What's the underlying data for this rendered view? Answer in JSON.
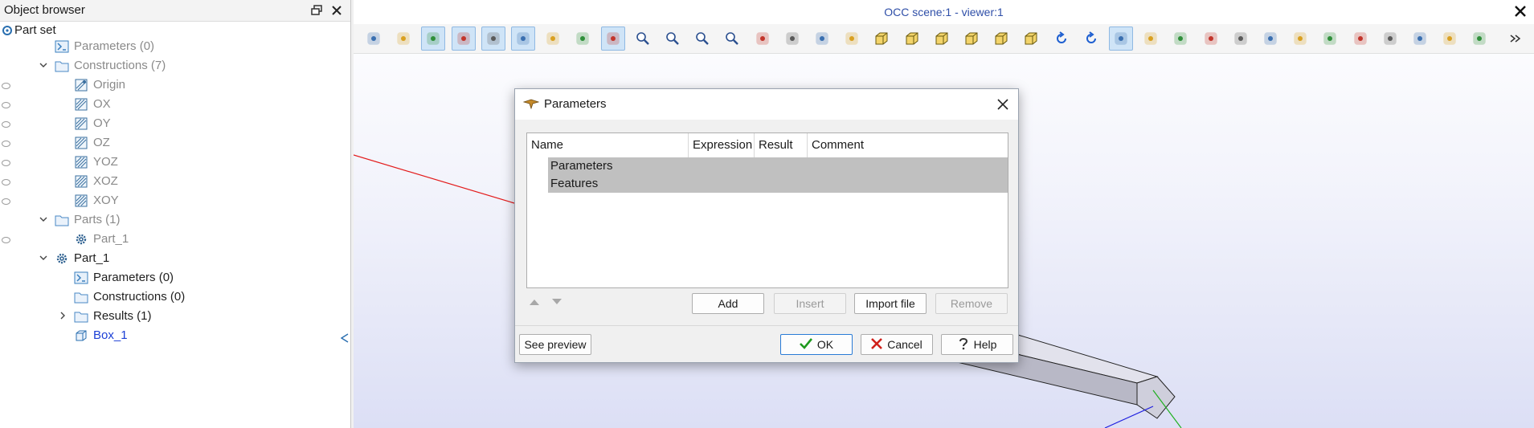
{
  "browser": {
    "title": "Object browser",
    "items": [
      {
        "label": "Part set",
        "style": "normal",
        "icon": "part-set-icon"
      },
      {
        "label": "Parameters (0)",
        "style": "dim",
        "icon": "parameters-icon"
      },
      {
        "label": "Constructions (7)",
        "style": "dim",
        "icon": "folder-icon",
        "expanded": true
      },
      {
        "label": "Origin",
        "style": "dim",
        "icon": "construction-point-icon"
      },
      {
        "label": "OX",
        "style": "dim",
        "icon": "construction-axis-icon"
      },
      {
        "label": "OY",
        "style": "dim",
        "icon": "construction-axis-icon"
      },
      {
        "label": "OZ",
        "style": "dim",
        "icon": "construction-axis-icon"
      },
      {
        "label": "YOZ",
        "style": "dim",
        "icon": "construction-plane-icon"
      },
      {
        "label": "XOZ",
        "style": "dim",
        "icon": "construction-plane-icon"
      },
      {
        "label": "XOY",
        "style": "dim",
        "icon": "construction-plane-icon"
      },
      {
        "label": "Parts (1)",
        "style": "dim",
        "icon": "folder-icon",
        "expanded": true
      },
      {
        "label": "Part_1",
        "style": "dim",
        "icon": "gear-icon"
      },
      {
        "label": "Part_1",
        "style": "normal",
        "icon": "gear-icon",
        "expanded": true
      },
      {
        "label": "Parameters (0)",
        "style": "normal",
        "icon": "parameters-icon"
      },
      {
        "label": "Constructions (0)",
        "style": "normal",
        "icon": "folder-icon"
      },
      {
        "label": "Results (1)",
        "style": "normal",
        "icon": "folder-icon",
        "collapsed": true
      },
      {
        "label": "Box_1",
        "style": "link",
        "icon": "box-icon"
      }
    ]
  },
  "viewer": {
    "title": "OCC scene:1 - viewer:1",
    "toolbar_icons": [
      "dump-view-icon",
      "fit-all-icon",
      "fit-area-icon",
      "select-icon",
      "select-rect-icon",
      "rectangle-icon",
      "polygon-icon",
      "circle-icon",
      "trihedron-icon",
      "zoom-icon",
      "zoom-area-icon",
      "zoom-in-icon",
      "zoom-out-icon",
      "pan-icon",
      "global-pan-icon",
      "rotate-icon",
      "rotation-point-icon",
      "view-front-icon",
      "view-back-icon",
      "view-top-icon",
      "view-bottom-icon",
      "view-left-icon",
      "view-right-icon",
      "rotate-ccw-icon",
      "rotate-cw-icon",
      "reset-view-icon",
      "shading-icon",
      "clipping-icon",
      "scaling-icon",
      "graduated-axes-icon",
      "ambient-icon",
      "projection-icon",
      "stereo-icon",
      "ray-tracing-icon",
      "env-texture-icon",
      "light-icon",
      "sync-icon",
      "view-manager-icon",
      "more-icon"
    ]
  },
  "dialog": {
    "title": "Parameters",
    "columns": [
      "Name",
      "Expression",
      "Result",
      "Comment"
    ],
    "rows": [
      "Parameters",
      "Features"
    ],
    "buttons": {
      "add": "Add",
      "insert": "Insert",
      "import": "Import file",
      "remove": "Remove",
      "preview": "See preview",
      "ok": "OK",
      "cancel": "Cancel",
      "help": "Help"
    }
  },
  "colors": {
    "accent_blue": "#1b3fd6",
    "title_blue": "#2f4fa8",
    "active_tool": "#cfe4f7",
    "row_highlight": "#c0c0c0",
    "ok_green": "#1f9a1f",
    "cancel_red": "#d0201a"
  }
}
